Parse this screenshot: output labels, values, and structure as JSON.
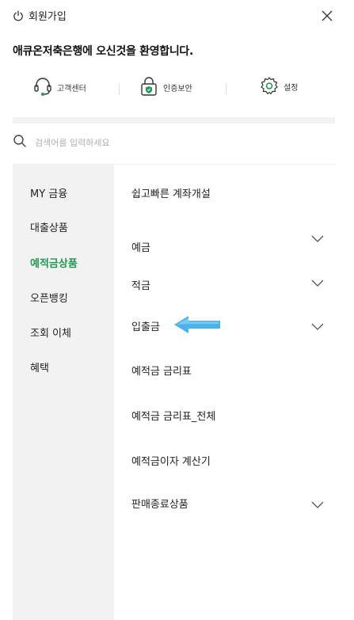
{
  "header": {
    "signup_label": "회원가입",
    "welcome_text": "애큐온저축은행에 오신것을 환영합니다."
  },
  "quick_links": [
    {
      "label": "고객센터",
      "icon": "headset-icon"
    },
    {
      "label": "인증보안",
      "icon": "shield-lock-icon"
    },
    {
      "label": "설정",
      "icon": "gear-icon"
    }
  ],
  "search": {
    "placeholder": "검색어를 입력하세요"
  },
  "sidebar": {
    "items": [
      {
        "label": "MY 금융"
      },
      {
        "label": "대출상품"
      },
      {
        "label": "예적금상품",
        "active": true
      },
      {
        "label": "오픈뱅킹"
      },
      {
        "label": "조회 이체"
      },
      {
        "label": "혜택"
      }
    ]
  },
  "menu": {
    "items": [
      {
        "label": "쉽고빠른 계좌개설",
        "expandable": false
      },
      {
        "label": "예금",
        "expandable": true
      },
      {
        "label": "적금",
        "expandable": true
      },
      {
        "label": "입출금",
        "expandable": true
      },
      {
        "label": "예적금 금리표",
        "expandable": false
      },
      {
        "label": "예적금 금리표_전체",
        "expandable": false
      },
      {
        "label": "예적금이자 계산기",
        "expandable": false
      },
      {
        "label": "판매종료상품",
        "expandable": true
      }
    ]
  },
  "colors": {
    "accent_green": "#1e9a52",
    "arrow_blue": "#4bb3ea",
    "sidebar_bg": "#f2f2f2"
  }
}
